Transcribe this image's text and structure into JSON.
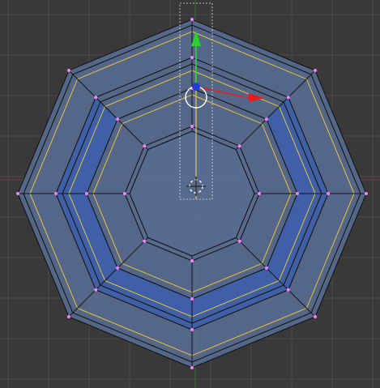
{
  "viewport": {
    "background": "#393939",
    "grid_color": "#4a4a4a",
    "x_axis_color": "#7a3a3a",
    "y_axis_color": "#3a6a3a",
    "view": "top-orthographic",
    "grid_visible": true
  },
  "mesh": {
    "face_fill": "#5a7096",
    "selected_face_fill": "#3d5faa",
    "edge_color": "#141414",
    "selected_edge_color": "#e8c43a",
    "vertex_color": "#ff7fff",
    "shape": "octagon-ring",
    "selection_state": "partial"
  },
  "manipulator": {
    "type": "translate",
    "x_axis_color": "#e81c1c",
    "y_axis_color": "#2bd12b",
    "z_axis_color": "#1d3fd6",
    "rotation_circle_color": "#ffffff"
  },
  "cursor_3d": {
    "visible": true,
    "icon": "crosshair-circle"
  }
}
